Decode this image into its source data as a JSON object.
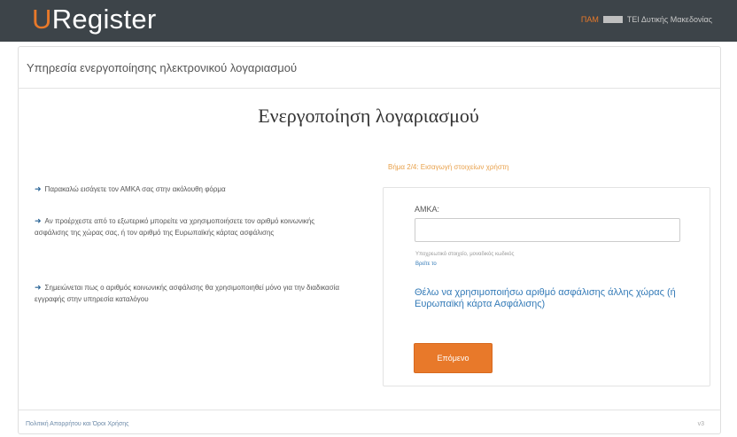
{
  "header": {
    "logo_first": "U",
    "logo_rest": "Register",
    "university_word": "ΠΑΜ",
    "university_name": "ΤΕΙ Δυτικής Μακεδονίας"
  },
  "page": {
    "subtitle": "Υπηρεσία ενεργοποίησης ηλεκτρονικού λογαριασμού",
    "heading": "Ενεργοποίηση λογαριασμού"
  },
  "instructions": [
    "Παρακαλώ εισάγετε τον ΑΜΚΑ σας στην ακόλουθη φόρμα",
    "Αν προέρχεστε από το εξωτερικό μπορείτε να χρησιμοποιήσετε τον αριθμό κοινωνικής ασφάλισης της χώρας σας, ή τον αριθμό της Ευρωπαϊκής κάρτας ασφάλισης",
    "Σημειώνεται πως ο αριθμός κοινωνικής ασφάλισης θα χρησιμοποιηθεί μόνο για την διαδικασία εγγραφής στην υπηρεσία καταλόγου"
  ],
  "form": {
    "step_title": "Βήμα 2/4: Εισαγωγή στοιχείων χρήστη",
    "amka_label": "ΑΜΚΑ:",
    "amka_value": "",
    "hint_text": "Υποχρεωτικό στοιχείο, μοναδικός κωδικός",
    "hint_link": "Βρείτε το",
    "alt_link": "Θέλω να χρησιμοποιήσω αριθμό ασφάλισης άλλης χώρας (ή Ευρωπαϊκή κάρτα Ασφάλισης)",
    "submit_label": "Επόμενο"
  },
  "footer": {
    "terms_link": "Πολιτική Απορρήτου και Όροι Χρήσης",
    "version": "v3"
  },
  "colors": {
    "topbar": "#3d4449",
    "accent": "#e8792a",
    "link": "#337ab7"
  }
}
